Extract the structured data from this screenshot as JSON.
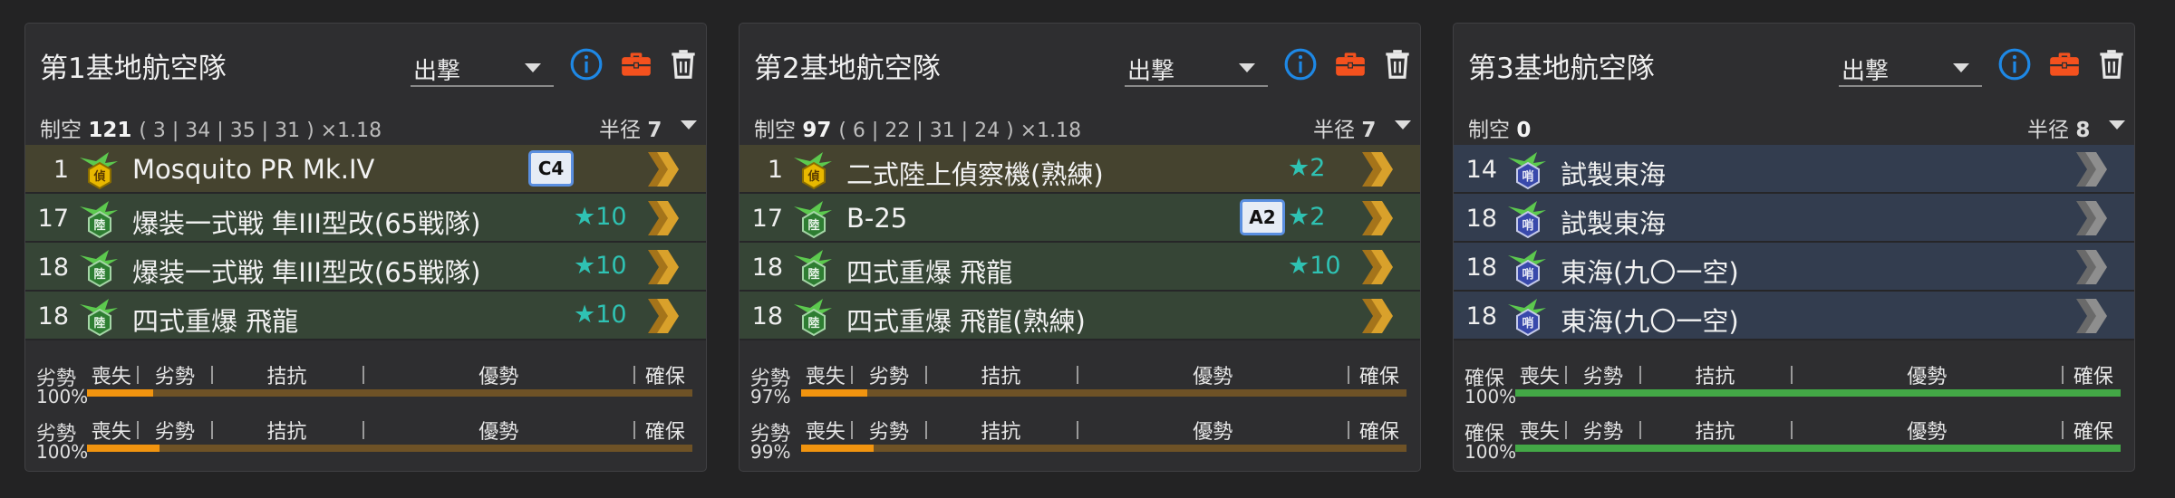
{
  "colors": {
    "background": "#232324",
    "panel": "#2e2e30",
    "recon_row": "#45432f",
    "bomber_row": "#364536",
    "fighter_row": "#333d4f",
    "info_blue": "#1e88e5",
    "job_orange": "#f4511e",
    "star_teal": "#2fc2b3",
    "gauge_orange": "#f1940f",
    "gauge_green": "#43a846"
  },
  "scale_labels": [
    "喪失",
    "劣勢",
    "拮抗",
    "優勢",
    "確保"
  ],
  "panels": [
    {
      "title": "第1基地航空隊",
      "mode": "出撃",
      "air_label": "制空",
      "air_value": "121",
      "air_detail": "( 3 | 34 | 35 | 31 ) ×1.18",
      "radius_label": "半径",
      "radius_value": "7",
      "icons": [
        "info-icon",
        "briefcase-icon",
        "trash-icon"
      ],
      "slots": [
        {
          "count": "1",
          "name": "Mosquito PR Mk.IV",
          "type": "recon",
          "icon_char": "偵",
          "badge": "C4",
          "stars": "",
          "chevron": "gold"
        },
        {
          "count": "17",
          "name": "爆装一式戦 隼III型改(65戦隊)",
          "type": "bomber",
          "icon_char": "陸",
          "badge": "",
          "stars": "10",
          "chevron": "gold"
        },
        {
          "count": "18",
          "name": "爆装一式戦 隼III型改(65戦隊)",
          "type": "bomber",
          "icon_char": "陸",
          "badge": "",
          "stars": "10",
          "chevron": "gold"
        },
        {
          "count": "18",
          "name": "四式重爆 飛龍",
          "type": "bomber",
          "icon_char": "陸",
          "badge": "",
          "stars": "10",
          "chevron": "gold"
        }
      ],
      "gauges": [
        {
          "status": "劣勢",
          "percent": "100%",
          "fill_fraction": 0.11,
          "color": "orange"
        },
        {
          "status": "劣勢",
          "percent": "100%",
          "fill_fraction": 0.12,
          "color": "orange"
        }
      ]
    },
    {
      "title": "第2基地航空隊",
      "mode": "出撃",
      "air_label": "制空",
      "air_value": "97",
      "air_detail": "( 6 | 22 | 31 | 24 ) ×1.18",
      "radius_label": "半径",
      "radius_value": "7",
      "icons": [
        "info-icon",
        "briefcase-icon",
        "trash-icon"
      ],
      "slots": [
        {
          "count": "1",
          "name": "二式陸上偵察機(熟練)",
          "type": "recon",
          "icon_char": "偵",
          "badge": "",
          "stars": "2",
          "chevron": "gold"
        },
        {
          "count": "17",
          "name": "B-25",
          "type": "bomber",
          "icon_char": "陸",
          "badge": "A2",
          "stars": "2",
          "chevron": "gold"
        },
        {
          "count": "18",
          "name": "四式重爆 飛龍",
          "type": "bomber",
          "icon_char": "陸",
          "badge": "",
          "stars": "10",
          "chevron": "gold"
        },
        {
          "count": "18",
          "name": "四式重爆 飛龍(熟練)",
          "type": "bomber",
          "icon_char": "陸",
          "badge": "",
          "stars": "",
          "chevron": "gold"
        }
      ],
      "gauges": [
        {
          "status": "劣勢",
          "percent": "97%",
          "fill_fraction": 0.11,
          "color": "orange"
        },
        {
          "status": "劣勢",
          "percent": "99%",
          "fill_fraction": 0.12,
          "color": "orange"
        }
      ]
    },
    {
      "title": "第3基地航空隊",
      "mode": "出撃",
      "air_label": "制空",
      "air_value": "0",
      "air_detail": "",
      "radius_label": "半径",
      "radius_value": "8",
      "icons": [
        "info-icon",
        "briefcase-icon",
        "trash-icon"
      ],
      "slots": [
        {
          "count": "14",
          "name": "試製東海",
          "type": "fighter",
          "icon_char": "哨",
          "badge": "",
          "stars": "",
          "chevron": "gray"
        },
        {
          "count": "18",
          "name": "試製東海",
          "type": "fighter",
          "icon_char": "哨",
          "badge": "",
          "stars": "",
          "chevron": "gray"
        },
        {
          "count": "18",
          "name": "東海(九〇一空)",
          "type": "fighter",
          "icon_char": "哨",
          "badge": "",
          "stars": "",
          "chevron": "gray"
        },
        {
          "count": "18",
          "name": "東海(九〇一空)",
          "type": "fighter",
          "icon_char": "哨",
          "badge": "",
          "stars": "",
          "chevron": "gray"
        }
      ],
      "gauges": [
        {
          "status": "確保",
          "percent": "100%",
          "fill_fraction": 1.0,
          "color": "green"
        },
        {
          "status": "確保",
          "percent": "100%",
          "fill_fraction": 1.0,
          "color": "green"
        }
      ]
    }
  ]
}
